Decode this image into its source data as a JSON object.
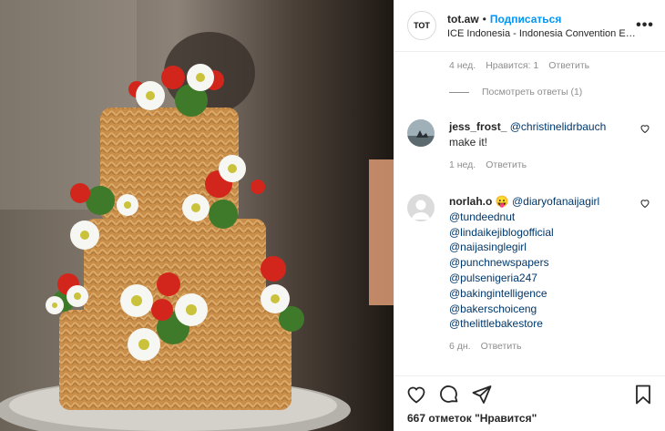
{
  "post": {
    "username": "tot.aw",
    "separator": "•",
    "follow_label": "Подписаться",
    "location": "ICE Indonesia - Indonesia Convention Exhibiti...",
    "avatar_text": "TOT",
    "more_label": "•••"
  },
  "comments_top": {
    "time": "4 нед.",
    "likes": "Нравится: 1",
    "reply": "Ответить",
    "view_replies": "Посмотреть ответы (1)"
  },
  "comments": [
    {
      "user": "jess_frost_",
      "mentions": [
        "@christinelidrbauch"
      ],
      "text": "make it!",
      "time": "1 нед.",
      "reply": "Ответить"
    },
    {
      "user": "norlah.o",
      "emoji": "😛",
      "mentions": [
        "@diaryofanaijagirl",
        "@tundeednut",
        "@lindaikejiblogofficial",
        "@naijasinglegirl",
        "@punchnewspapers",
        "@pulsenigeria247",
        "@bakingintelligence",
        "@bakerschoiceng",
        "@thelittlebakestore"
      ],
      "time": "6 дн.",
      "reply": "Ответить"
    }
  ],
  "footer": {
    "likes_count": "667",
    "likes_label": "отметок \"Нравится\""
  },
  "icons": [
    "heart-icon",
    "comment-icon",
    "share-icon",
    "bookmark-icon",
    "more-icon"
  ],
  "colors": {
    "link": "#0095f6",
    "mention": "#00376b",
    "muted": "#8e8e8e"
  }
}
